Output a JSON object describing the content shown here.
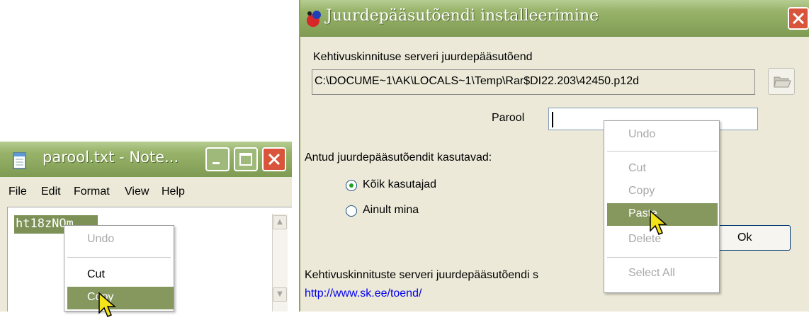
{
  "notepad": {
    "title": "parool.txt - Note...",
    "menu": [
      "File",
      "Edit",
      "Format",
      "View",
      "Help"
    ],
    "content": "ht18zNOm"
  },
  "notepad_context_menu": {
    "items": [
      {
        "label": "Undo",
        "enabled": false
      },
      {
        "label": "Cut",
        "enabled": true
      },
      {
        "label": "Copy",
        "enabled": true,
        "highlighted": true
      }
    ]
  },
  "dialog": {
    "title": "Juurdepääsutõendi installeerimine",
    "cert_label": "Kehtivuskinnituse serveri juurdepääsutõend",
    "cert_path": "C:\\DOCUME~1\\AK\\LOCALS~1\\Temp\\Rar$DI22.203\\42450.p12d",
    "password_label": "Parool",
    "password_value": "",
    "users_label": "Antud juurdepääsutõendit kasutavad:",
    "radio_all": "Kõik kasutajad",
    "radio_me": "Ainult mina",
    "selected_radio": "Kõik kasutajad",
    "ok_label": "Ok",
    "footer_text": "Kehtivuskinnituste serveri juurdepääsutõendi s",
    "footer_link": "http://www.sk.ee/toend/"
  },
  "dialog_context_menu": {
    "items": [
      {
        "label": "Undo",
        "enabled": false
      },
      {
        "label": "Cut",
        "enabled": false
      },
      {
        "label": "Copy",
        "enabled": false
      },
      {
        "label": "Paste",
        "enabled": true,
        "highlighted": true
      },
      {
        "label": "Delete",
        "enabled": false
      },
      {
        "label": "Select All",
        "enabled": false
      }
    ]
  },
  "colors": {
    "title_bar": "#8aa55c",
    "selection": "#7d9157",
    "menu_highlight": "#87985f",
    "close_button": "#d8543a"
  }
}
